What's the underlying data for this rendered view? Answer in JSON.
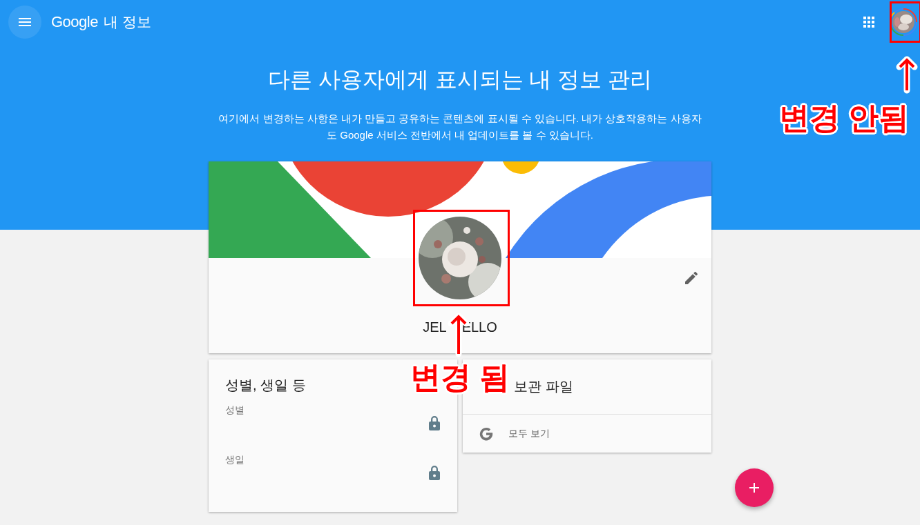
{
  "app_bar": {
    "brand": "Google",
    "title": "내 정보"
  },
  "heading": "다른 사용자에게 표시되는 내 정보 관리",
  "description": "여기에서 변경하는 사항은 내가 만들고 공유하는 콘텐츠에 표시될 수 있습니다. 내가 상호작용하는 사용자도 Google 서비스 전반에서 내 업데이트를 볼 수 있습니다.",
  "profile": {
    "name_start": "JEL",
    "name_end": "ELLO"
  },
  "about_card": {
    "title": "성별, 생일 등",
    "fields": [
      {
        "label": "성별",
        "locked": true
      },
      {
        "label": "생일",
        "locked": true
      }
    ]
  },
  "archive_card": {
    "title": "보관 파일",
    "link": "모두 보기"
  },
  "annotations": [
    {
      "kind": "account",
      "text": "변경 안됨"
    },
    {
      "text": "변경 됨"
    }
  ]
}
